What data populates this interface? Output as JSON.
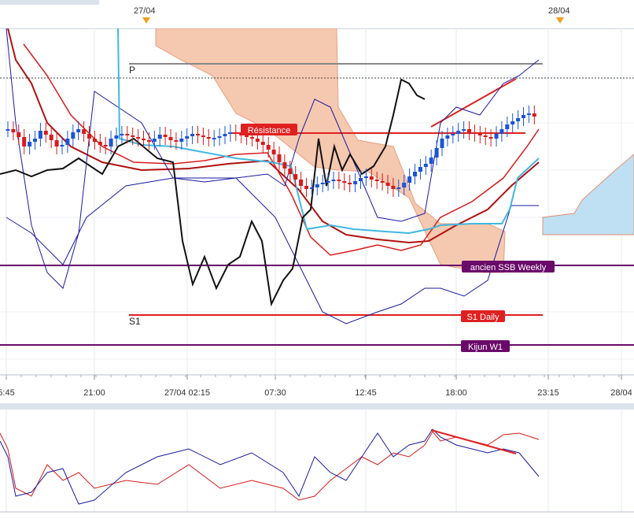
{
  "header": {
    "dates": [
      {
        "label": "27/04",
        "marker_color": "#f0a020"
      },
      {
        "label": "28/04",
        "marker_color": "#f0a020"
      }
    ]
  },
  "chart_data": [
    {
      "type": "candlestick",
      "title": "",
      "x_ticks": [
        "5:45",
        "21:00",
        "27/04 02:15",
        "07:30",
        "12:45",
        "18:00",
        "23:15",
        "28/04"
      ],
      "grid": true,
      "pivot_dotted_line": true,
      "annotations": [
        {
          "text": "P",
          "color": "#888888"
        },
        {
          "text": "Résistance",
          "color": "#e02020"
        },
        {
          "text": "ancien SSB Weekly",
          "color": "#6a0a6a"
        },
        {
          "text": "S1",
          "color": "#e02020"
        },
        {
          "text": "S1 Daily",
          "color": "#e02020"
        },
        {
          "text": "Kijun W1",
          "color": "#6a0a6a"
        }
      ],
      "series": [
        {
          "type": "candles",
          "up_color": "#1a55d6",
          "down_color": "#d81a1a",
          "closes": [
            312,
            308,
            302,
            290,
            296,
            300,
            310,
            305,
            298,
            290,
            292,
            300,
            308,
            312,
            306,
            300,
            296,
            292,
            290,
            300,
            304,
            306,
            304,
            302,
            300,
            298,
            296,
            300,
            305,
            302,
            298,
            296,
            300,
            303,
            306,
            304,
            302,
            300,
            301,
            303,
            306,
            308,
            307,
            304,
            302,
            300,
            296,
            292,
            286,
            280,
            270,
            262,
            255,
            248,
            240,
            236,
            238,
            242,
            244,
            246,
            248,
            246,
            244,
            242,
            246,
            250,
            252,
            248,
            246,
            244,
            240,
            236,
            238,
            244,
            252,
            258,
            264,
            268,
            276,
            288,
            300,
            304,
            306,
            310,
            312,
            308,
            306,
            304,
            302,
            300,
            306,
            312,
            318,
            322,
            326,
            330,
            332,
            328
          ]
        },
        {
          "type": "line",
          "name": "",
          "color": "#b01010"
        },
        {
          "type": "line",
          "name": "",
          "color": "#d81a1a"
        },
        {
          "type": "line",
          "name": "",
          "color": "#1a1aa0"
        },
        {
          "type": "line",
          "name": "",
          "color": "#40b8e0"
        },
        {
          "type": "line",
          "name": "",
          "color": "#111111"
        },
        {
          "type": "area",
          "name": "",
          "color": "#f5c8b0"
        },
        {
          "type": "area",
          "name": "",
          "color": "#bfe0f2"
        }
      ]
    },
    {
      "type": "line",
      "title": "",
      "series": [
        {
          "name": "",
          "color": "#d81a1a"
        },
        {
          "name": "",
          "color": "#1a1aa0"
        }
      ]
    }
  ]
}
